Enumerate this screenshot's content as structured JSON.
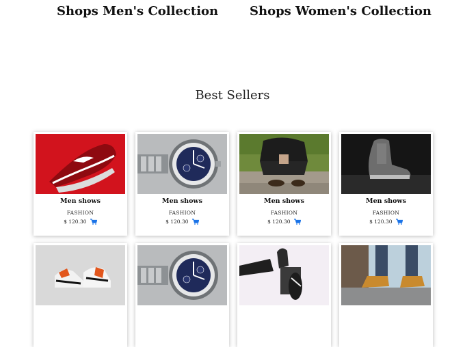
{
  "collections": {
    "men": "Shops Men's Collection",
    "women": "Shops Women's Collection"
  },
  "best_sellers": {
    "title": "Best Sellers",
    "products": [
      {
        "name": "Men shows",
        "category": "FASHION",
        "price": "$ 120.30"
      },
      {
        "name": "Men shows",
        "category": "FASHION",
        "price": "$ 120.30"
      },
      {
        "name": "Men shows",
        "category": "FASHION",
        "price": "$ 120.30"
      },
      {
        "name": "Men shows",
        "category": "FASHION",
        "price": "$ 120.30"
      }
    ]
  },
  "colors": {
    "cart_icon": "#1a73e8"
  }
}
